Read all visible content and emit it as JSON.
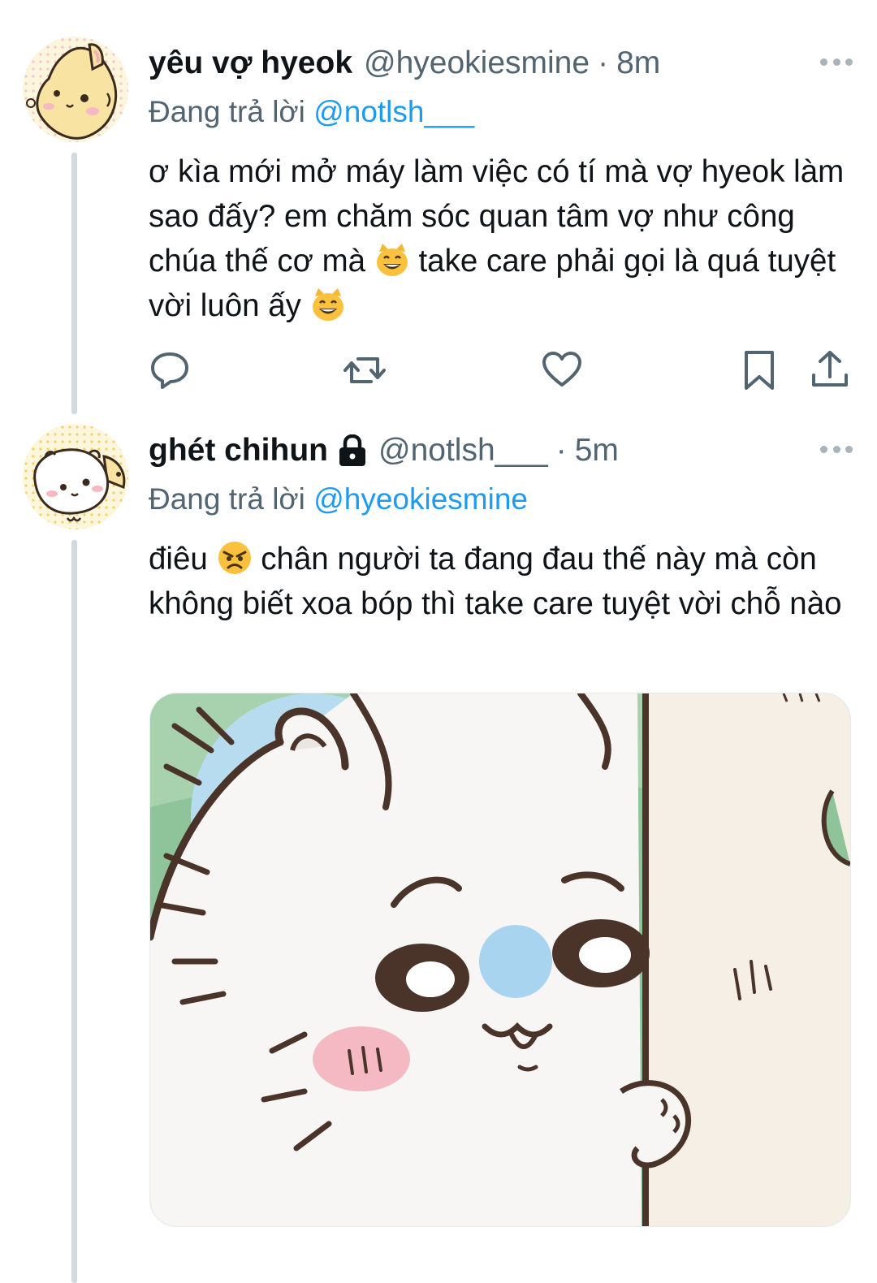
{
  "tweets": [
    {
      "display_name": "yêu vợ hyeok",
      "handle": "@hyeokiesmine",
      "separator": "·",
      "time": "8m",
      "replying_prefix": "Đang trả lời",
      "replying_to": "@notlsh___",
      "text_parts": [
        "ơ kìa mới mở máy làm việc có tí mà vợ hyeok làm sao đấy? em chăm sóc quan tâm vợ như công chúa thế cơ mà ",
        " take care phải gọi là quá tuyệt vời luôn ấy "
      ],
      "emojis": [
        "grinning-cat-emoji",
        "grinning-cat-emoji"
      ],
      "actions": [
        "reply-icon",
        "retweet-icon",
        "like-icon",
        "bookmark-icon",
        "share-icon"
      ]
    },
    {
      "display_name": "ghét chihun",
      "protected_icon": "lock-icon",
      "handle": "@notlsh___",
      "separator": "·",
      "time": "5m",
      "replying_prefix": "Đang trả lời",
      "replying_to": "@hyeokiesmine",
      "text_parts": [
        "điêu ",
        " chân người ta đang đau thế này mà còn không biết xoa bóp thì take care tuyệt vời chỗ nào"
      ],
      "emojis": [
        "angry-face-emoji"
      ],
      "media": "cartoon-hamster-peeking-image"
    }
  ],
  "colors": {
    "link": "#1d9bf0",
    "secondary_text": "#536471",
    "thread_line": "#cfd9de"
  }
}
